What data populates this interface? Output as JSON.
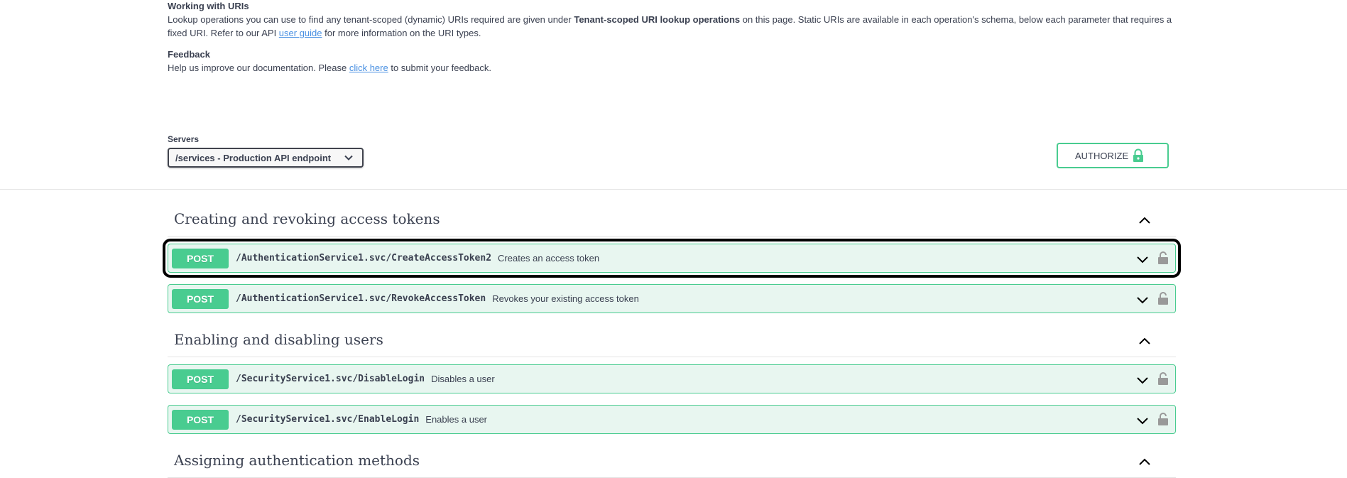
{
  "info": {
    "uris_heading": "Working with URIs",
    "uris_text_1": "Lookup operations you can use to find any tenant-scoped (dynamic) URIs required are given under ",
    "uris_text_bold": "Tenant-scoped URI lookup operations",
    "uris_text_2": " on this page. Static URIs are available in each operation's schema, below each parameter that requires a fixed URI. Refer to our API ",
    "uris_link": "user guide",
    "uris_text_3": " for more information on the URI types.",
    "feedback_heading": "Feedback",
    "feedback_text_1": "Help us improve our documentation. Please ",
    "feedback_link": "click here",
    "feedback_text_2": " to submit your feedback."
  },
  "servers": {
    "label": "Servers",
    "selected": "/services - Production API endpoint"
  },
  "authorize": {
    "label": "AUTHORIZE"
  },
  "tags": [
    {
      "title": "Creating and revoking access tokens",
      "operations": [
        {
          "method": "POST",
          "path": "/AuthenticationService1.svc/CreateAccessToken2",
          "description": "Creates an access token"
        },
        {
          "method": "POST",
          "path": "/AuthenticationService1.svc/RevokeAccessToken",
          "description": "Revokes your existing access token"
        }
      ]
    },
    {
      "title": "Enabling and disabling users",
      "operations": [
        {
          "method": "POST",
          "path": "/SecurityService1.svc/DisableLogin",
          "description": "Disables a user"
        },
        {
          "method": "POST",
          "path": "/SecurityService1.svc/EnableLogin",
          "description": "Enables a user"
        }
      ]
    },
    {
      "title": "Assigning authentication methods",
      "operations": []
    }
  ],
  "colors": {
    "post": "#49cc90",
    "post_bg": "#e8f6f0",
    "text": "#3b4151",
    "link": "#4990e2",
    "highlight": "#000000"
  },
  "icons": {
    "select": "chevron-down-icon",
    "authorize": "lock-icon",
    "tag": "chevron-up-icon",
    "operation_expand": "chevron-down-icon",
    "operation_lock": "unlocked-icon"
  }
}
